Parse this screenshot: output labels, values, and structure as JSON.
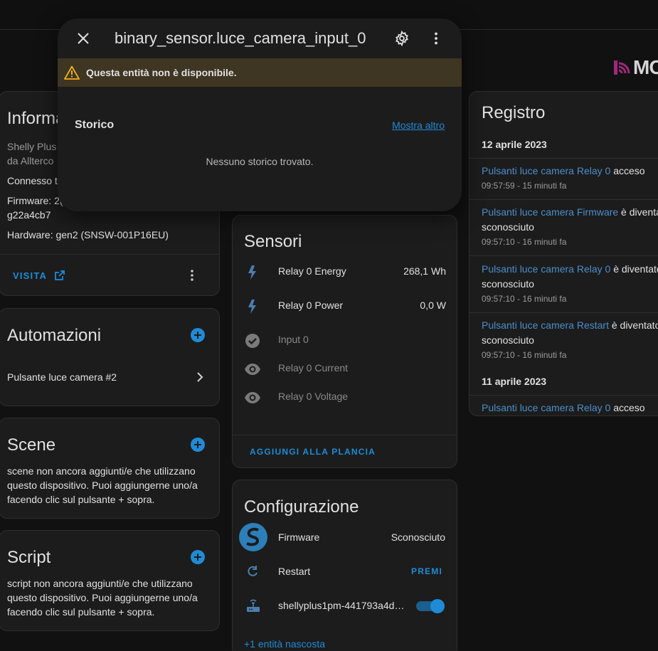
{
  "dialog": {
    "title": "binary_sensor.luce_camera_input_0",
    "warning": "Questa entità non è disponibile.",
    "history_title": "Storico",
    "show_more": "Mostra altro",
    "no_history": "Nessuno storico trovato."
  },
  "logo": {
    "text": "MO"
  },
  "info": {
    "title": "Informa",
    "model_line1": "Shelly Plus",
    "model_line2": "da Allterco",
    "connected": "Connesso t",
    "firmware_line1": "Firmware: 2(",
    "firmware_line2": "g22a4cb7",
    "hardware": "Hardware: gen2 (SNSW-001P16EU)",
    "visit_label": "VISITA"
  },
  "automations": {
    "title": "Automazioni",
    "item": "Pulsante luce camera #2"
  },
  "scenes": {
    "title": "Scene",
    "line1": "scene non ancora aggiunti/e che utilizzano",
    "line2": "questo dispositivo. Puoi aggiungerne uno/a",
    "line3": "facendo clic sul pulsante + sopra."
  },
  "scripts": {
    "title": "Script",
    "line1": "script non ancora aggiunti/e che utilizzano",
    "line2": "questo dispositivo. Puoi aggiungerne uno/a",
    "line3": "facendo clic sul pulsante + sopra."
  },
  "sensors": {
    "title": "Sensori",
    "items": [
      {
        "name": "Relay 0 Energy",
        "value": "268,1 Wh",
        "icon": "flash-icon"
      },
      {
        "name": "Relay 0 Power",
        "value": "0,0 W",
        "icon": "flash-icon"
      },
      {
        "name": "Input 0",
        "value": "",
        "icon": "check-circle-icon"
      },
      {
        "name": "Relay 0 Current",
        "value": "",
        "icon": "eye-icon"
      },
      {
        "name": "Relay 0 Voltage",
        "value": "",
        "icon": "eye-icon"
      }
    ],
    "add_label": "AGGIUNGI ALLA PLANCIA"
  },
  "config": {
    "title": "Configurazione",
    "firmware_label": "Firmware",
    "firmware_value": "Sconosciuto",
    "restart_label": "Restart",
    "restart_action": "PREMI",
    "device_label": "shellyplus1pm-441793a4d…",
    "hidden_entities": "+1 entità nascosta"
  },
  "log": {
    "title": "Registro",
    "date1": "12 aprile 2023",
    "entries1": [
      {
        "entity": "Pulsanti luce camera Relay 0",
        "action": " acceso",
        "cont": "",
        "time": "09:57:59 - 15 minuti fa"
      },
      {
        "entity": "Pulsanti luce camera Firmware",
        "action": " è diventa",
        "cont": "sconosciuto",
        "time": "09:57:10 - 16 minuti fa"
      },
      {
        "entity": "Pulsanti luce camera Relay 0",
        "action": " è diventato",
        "cont": "sconosciuto",
        "time": "09:57:10 - 16 minuti fa"
      },
      {
        "entity": "Pulsanti luce camera Restart",
        "action": " è diventato",
        "cont": "sconosciuto",
        "time": "09:57:10 - 16 minuti fa"
      }
    ],
    "date2": "11 aprile 2023",
    "entries2": [
      {
        "entity": "Pulsanti luce camera Relay 0",
        "action": " acceso"
      }
    ]
  },
  "colors": {
    "accent": "#1f8bd6",
    "warning_bg": "#3e3522",
    "warning_icon": "#f2b01e",
    "log_entity": "#4b8ec9"
  }
}
